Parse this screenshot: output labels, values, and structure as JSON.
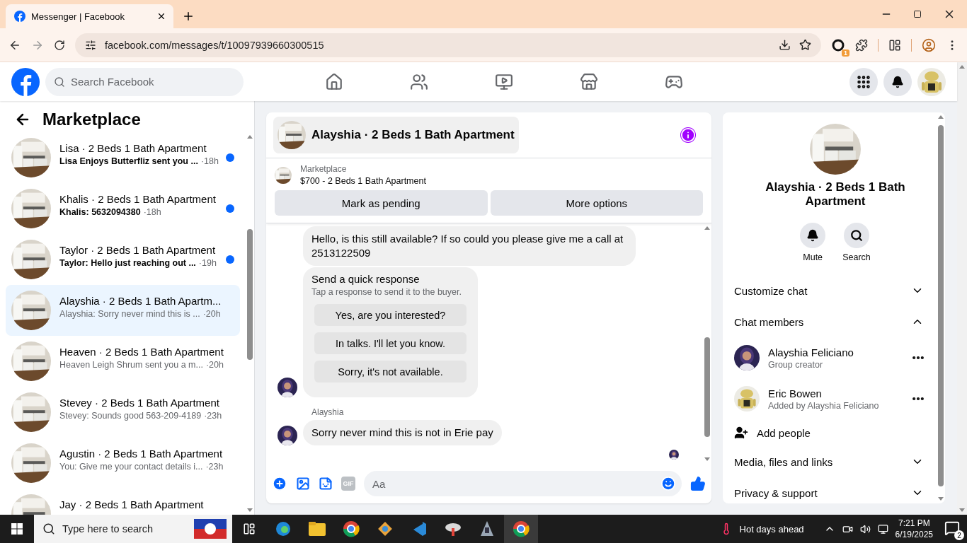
{
  "browser": {
    "tab_title": "Messenger | Facebook",
    "url": "facebook.com/messages/t/10097939660300515",
    "extension_badge": "1"
  },
  "header": {
    "search_placeholder": "Search Facebook"
  },
  "sidebar": {
    "title": "Marketplace",
    "conversations": [
      {
        "name": "Lisa · 2 Beds 1 Bath Apartment",
        "preview": "Lisa Enjoys Butterfliz sent you ...",
        "time": "·18h",
        "unread": true,
        "selected": false
      },
      {
        "name": "Khalis · 2 Beds 1 Bath Apartment",
        "preview": "Khalis: 5632094380",
        "time": "·18h",
        "unread": true,
        "selected": false
      },
      {
        "name": "Taylor · 2 Beds 1 Bath Apartment",
        "preview": "Taylor: Hello just reaching out ...",
        "time": "·19h",
        "unread": true,
        "selected": false
      },
      {
        "name": "Alayshia · 2 Beds 1 Bath Apartm...",
        "preview": "Alayshia: Sorry never mind this is ...",
        "time": "·20h",
        "unread": false,
        "selected": true
      },
      {
        "name": "Heaven · 2 Beds 1 Bath Apartment",
        "preview": "Heaven Leigh Shrum sent you a m...",
        "time": "·20h",
        "unread": false,
        "selected": false
      },
      {
        "name": "Stevey · 2 Beds 1 Bath Apartment",
        "preview": "Stevey: Sounds good 563-209-4189",
        "time": "·23h",
        "unread": false,
        "selected": false
      },
      {
        "name": "Agustin · 2 Beds 1 Bath Apartment",
        "preview": "You: Give me your contact details i...",
        "time": "·23h",
        "unread": false,
        "selected": false
      },
      {
        "name": "Jay · 2 Beds 1 Bath Apartment",
        "unread": false,
        "selected": false
      }
    ]
  },
  "chat": {
    "title": "Alayshia · 2 Beds 1 Bath Apartment",
    "listing": {
      "label": "Marketplace",
      "title": "$700 - 2 Beds 1 Bath Apartment"
    },
    "actions": [
      "Mark as pending",
      "More options"
    ],
    "messages": [
      {
        "kind": "text",
        "text": "Hello, is this still available? If so could you please give me a call at 2513122509",
        "avatar": false
      },
      {
        "kind": "quick",
        "title": "Send a quick response",
        "hint": "Tap a response to send it to the buyer.",
        "options": [
          "Yes, are you interested?",
          "In talks. I'll let you know.",
          "Sorry, it's not available."
        ],
        "avatar": true
      },
      {
        "kind": "text",
        "sender": "Alayshia",
        "text": "Sorry never mind this is not in Erie pay",
        "avatar": true
      }
    ],
    "composer": {
      "gif_label": "GIF",
      "placeholder": "Aa"
    }
  },
  "details": {
    "name": "Alayshia · 2 Beds 1 Bath Apartment",
    "actions": [
      {
        "kind": "mute",
        "label": "Mute"
      },
      {
        "kind": "search",
        "label": "Search"
      }
    ],
    "sections": [
      {
        "label": "Customize chat",
        "expanded": false
      },
      {
        "label": "Chat members",
        "expanded": true,
        "members": [
          {
            "name": "Alayshia Feliciano",
            "role": "Group creator"
          },
          {
            "name": "Eric Bowen",
            "role": "Added by Alayshia Feliciano"
          }
        ],
        "add_label": "Add people"
      },
      {
        "label": "Media, files and links",
        "expanded": false
      },
      {
        "label": "Privacy & support",
        "expanded": false
      }
    ]
  },
  "taskbar": {
    "search_placeholder": "Type here to search",
    "weather": "Hot days ahead",
    "time": "7:21 PM",
    "date": "6/19/2025",
    "notifications": "2"
  }
}
